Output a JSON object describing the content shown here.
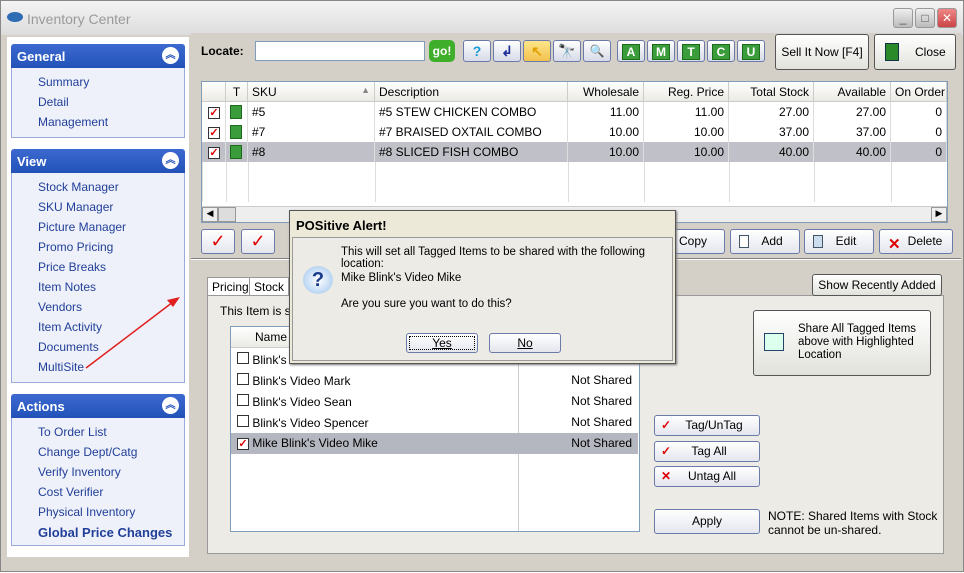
{
  "window": {
    "title": "Inventory Center",
    "controls": [
      "_",
      "□",
      "✕"
    ]
  },
  "sidebar": {
    "general": {
      "title": "General",
      "items": [
        "Summary",
        "Detail",
        "Management"
      ]
    },
    "view": {
      "title": "View",
      "items": [
        "Stock Manager",
        "SKU Manager",
        "Picture Manager",
        "Promo Pricing",
        "Price Breaks",
        "Item Notes",
        "Vendors",
        "Item Activity",
        "Documents",
        "MultiSite"
      ]
    },
    "actions": {
      "title": "Actions",
      "items": [
        "To Order List",
        "Change Dept/Catg",
        "Verify Inventory",
        "Cost Verifier",
        "Physical Inventory",
        "Global Price Changes"
      ]
    }
  },
  "toolbar": {
    "locate_label": "Locate:",
    "locate_value": "",
    "go_label": "go!",
    "filter_buttons": [
      "A",
      "M",
      "T",
      "C",
      "U"
    ],
    "sell_label": "Sell It Now [F4]",
    "close_label": "Close"
  },
  "grid": {
    "columns": [
      "T",
      "SKU",
      "Description",
      "Wholesale",
      "Reg. Price",
      "Total Stock",
      "Available",
      "On Order"
    ],
    "rows": [
      {
        "tagged": true,
        "sku": "#5",
        "description": "#5 STEW CHICKEN COMBO",
        "wholesale": "11.00",
        "reg_price": "11.00",
        "total_stock": "27.00",
        "available": "27.00",
        "on_order": "0"
      },
      {
        "tagged": true,
        "sku": "#7",
        "description": "#7 BRAISED OXTAIL COMBO",
        "wholesale": "10.00",
        "reg_price": "10.00",
        "total_stock": "37.00",
        "available": "37.00",
        "on_order": "0"
      },
      {
        "tagged": true,
        "sku": "#8",
        "description": "#8 SLICED FISH COMBO",
        "wholesale": "10.00",
        "reg_price": "10.00",
        "total_stock": "40.00",
        "available": "40.00",
        "on_order": "0",
        "selected": true
      }
    ]
  },
  "actions_bar": {
    "copy": "Copy",
    "add": "Add",
    "edit": "Edit",
    "delete": "Delete"
  },
  "lower": {
    "tabs": [
      "Pricing",
      "Stock"
    ],
    "shared_text": "This Item is sha",
    "show_recent": "Show Recently Added",
    "list_header": "Name",
    "locations": [
      {
        "name": "Blink's V",
        "status": "",
        "checked": false
      },
      {
        "name": "Blink's Video Mark",
        "status": "Not Shared",
        "checked": false
      },
      {
        "name": "Blink's Video Sean",
        "status": "Not Shared",
        "checked": false
      },
      {
        "name": "Blink's Video Spencer",
        "status": "Not Shared",
        "checked": false
      },
      {
        "name": "Mike Blink's Video Mike",
        "status": "Not Shared",
        "checked": true,
        "selected": true
      }
    ],
    "share_all": "Share All Tagged Items above with Highlighted Location",
    "tag_untag": "Tag/UnTag",
    "tag_all": "Tag All",
    "untag_all": "Untag All",
    "apply": "Apply",
    "note_line1": "NOTE: Shared Items with Stock",
    "note_line2": "cannot be un-shared."
  },
  "dialog": {
    "title": "POSitive Alert!",
    "line1": "This will set all Tagged Items to be shared with the following location:",
    "location": "Mike Blink's Video Mike",
    "question": "Are you sure you want to do this?",
    "yes": "Yes",
    "no": "No"
  }
}
